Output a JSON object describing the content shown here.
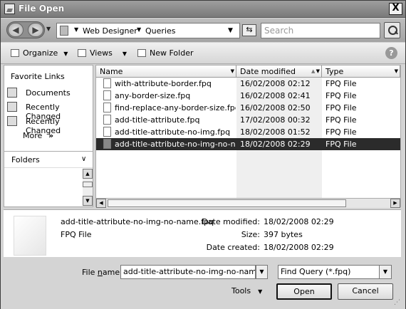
{
  "window": {
    "title": "File Open",
    "close_glyph": "X"
  },
  "address": {
    "crumbs": [
      "Web Designer",
      "Queries"
    ],
    "search_placeholder": "Search",
    "back_glyph": "◀",
    "forward_glyph": "▶",
    "refresh_glyph": "⇆"
  },
  "toolbar": {
    "organize": "Organize",
    "views": "Views",
    "new_folder": "New Folder",
    "help": "?"
  },
  "nav": {
    "favorite_links": "Favorite Links",
    "items": [
      "Documents",
      "Recently Changed",
      "Recently Changed"
    ],
    "more": "More",
    "more_glyph": "»",
    "folders": "Folders"
  },
  "columns": {
    "name": "Name",
    "date": "Date modified",
    "type": "Type"
  },
  "files": [
    {
      "name": "with-attribute-border.fpq",
      "date": "16/02/2008 02:12",
      "type": "FPQ File"
    },
    {
      "name": "any-border-size.fpq",
      "date": "16/02/2008 02:41",
      "type": "FPQ File"
    },
    {
      "name": "find-replace-any-border-size.fpq",
      "date": "16/02/2008 02:50",
      "type": "FPQ File"
    },
    {
      "name": "add-title-attribute.fpq",
      "date": "17/02/2008 00:32",
      "type": "FPQ File"
    },
    {
      "name": "add-title-attribute-no-img.fpq",
      "date": "18/02/2008 01:52",
      "type": "FPQ File"
    },
    {
      "name": "add-title-attribute-no-img-no-name....",
      "date": "18/02/2008 02:29",
      "type": "FPQ File",
      "selected": true
    }
  ],
  "details": {
    "name": "add-title-attribute-no-img-no-name.fpq",
    "type": "FPQ File",
    "date_modified_label": "Date modified:",
    "date_modified": "18/02/2008 02:29",
    "size_label": "Size:",
    "size": "397 bytes",
    "date_created_label": "Date created:",
    "date_created": "18/02/2008 02:29"
  },
  "bottom": {
    "file_name_label_pre": "File ",
    "file_name_label_ul": "n",
    "file_name_label_post": "ame:",
    "file_name_value": "add-title-attribute-no-img-no-name.fpq",
    "filter": "Find Query (*.fpq)",
    "tools": "Tools",
    "open": "Open",
    "cancel": "Cancel"
  }
}
